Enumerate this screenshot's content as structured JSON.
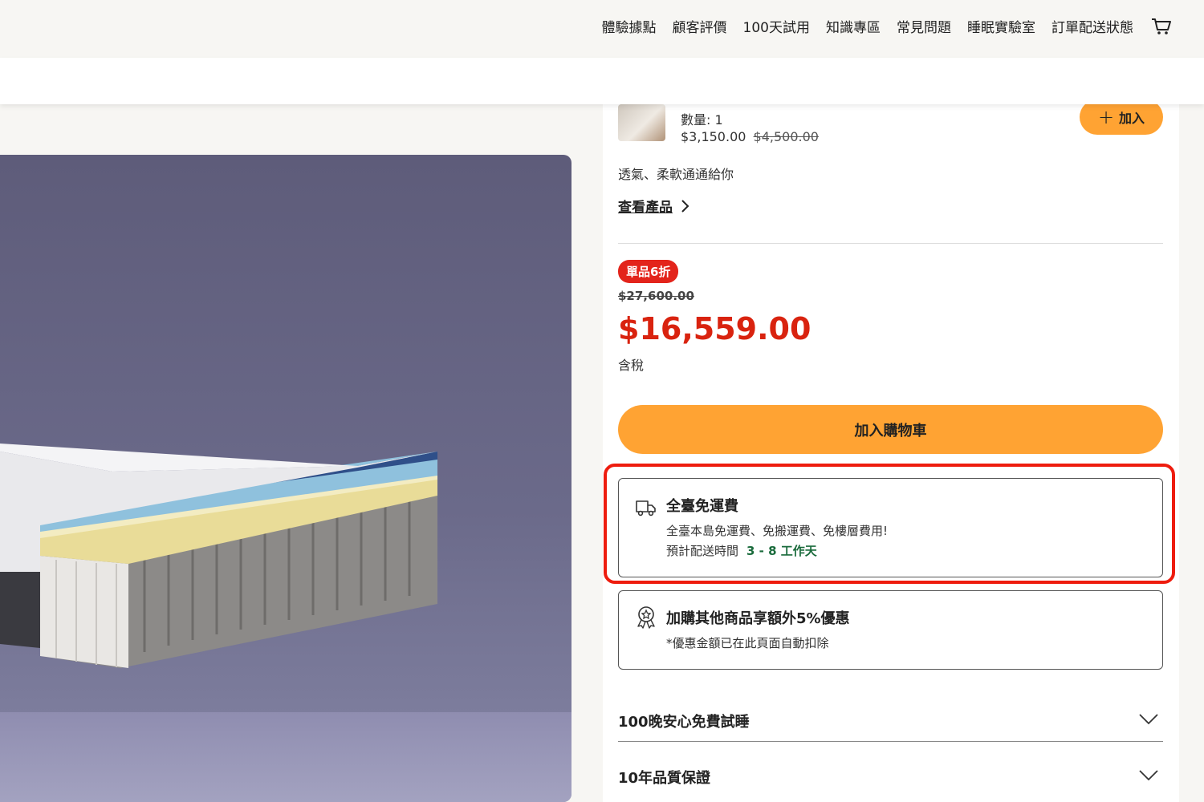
{
  "nav": {
    "items": [
      "體驗據點",
      "顧客評價",
      "100天試用",
      "知識專區",
      "常見問題",
      "睡眠實驗室",
      "訂單配送狀態"
    ],
    "cart_icon": "cart-icon"
  },
  "addon": {
    "quantity": "數量: 1",
    "price": "$3,150.00",
    "original_price": "$4,500.00",
    "add_label": "加入",
    "description": "透氣、柔軟通通給你",
    "view_link": "查看產品"
  },
  "pricing": {
    "badge": "單品6折",
    "original_price": "$27,600.00",
    "sale_price": "$16,559.00",
    "tax_note": "含稅"
  },
  "add_to_cart_label": "加入購物車",
  "shipping": {
    "icon": "truck-icon",
    "title": "全臺免運費",
    "line1": "全臺本島免運費、免搬運費、免樓層費用!",
    "delivery_label": "預計配送時間",
    "delivery_days": "3 - 8 工作天"
  },
  "bundle_offer": {
    "icon": "award-badge-icon",
    "title": "加購其他商品享額外5%優惠",
    "note": "*優惠金額已在此頁面自動扣除"
  },
  "accordions": [
    "100晚安心免費試睡",
    "10年品質保證"
  ],
  "colors": {
    "accent_orange": "#ffa333",
    "sale_red": "#d9230f",
    "highlight_red": "#ee1c0e",
    "delivery_green": "#1a6b3c"
  }
}
